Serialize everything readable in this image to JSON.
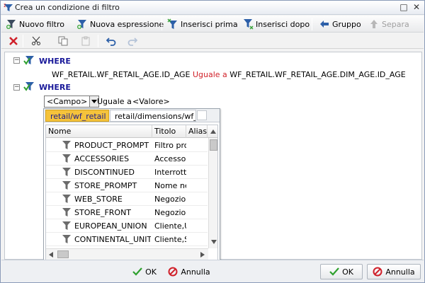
{
  "window": {
    "title": "Crea un condizione di filtro",
    "restore_symbol": "□",
    "close_symbol": "✕"
  },
  "toolbar": {
    "items": [
      {
        "label": "Nuovo filtro",
        "icon": "new-filter-icon"
      },
      {
        "label": "Nuova espressione",
        "icon": "new-expression-icon"
      },
      {
        "label": "Inserisci prima",
        "icon": "insert-before-icon"
      },
      {
        "label": "Inserisci dopo",
        "icon": "insert-after-icon"
      },
      {
        "label": "Gruppo",
        "icon": "group-icon"
      },
      {
        "label": "Separa",
        "icon": "separate-icon",
        "disabled": true
      }
    ]
  },
  "toolbar2": {
    "icons": [
      "delete-icon",
      "cut-icon",
      "copy-icon",
      "paste-icon",
      "undo-icon",
      "redo-icon"
    ]
  },
  "filters": [
    {
      "label": "WHERE",
      "left": "WF_RETAIL.WF_RETAIL_AGE.ID_AGE",
      "operator": "Uguale a",
      "right": "WF_RETAIL.WF_RETAIL_AGE.DIM_AGE.ID_AGE"
    },
    {
      "label": "WHERE",
      "field_placeholder": "<Campo>",
      "operator": "Uguale a",
      "value_placeholder": "<Valore>"
    }
  ],
  "field_picker": {
    "tabs": [
      "retail/wf_retail",
      "retail/dimensions/wf_re"
    ],
    "active_tab": 0,
    "columns": [
      "Nome",
      "Titolo",
      "Alias"
    ],
    "rows": [
      {
        "name": "PRODUCT_PROMPT",
        "title": "Filtro pro"
      },
      {
        "name": "ACCESSORIES",
        "title": "Accessori"
      },
      {
        "name": "DISCONTINUED",
        "title": "Interrotto"
      },
      {
        "name": "STORE_PROMPT",
        "title": "Nome neg"
      },
      {
        "name": "WEB_STORE",
        "title": "Negozio w"
      },
      {
        "name": "STORE_FRONT",
        "title": "Negozio a"
      },
      {
        "name": "EUROPEAN_UNION",
        "title": "Cliente,U"
      },
      {
        "name": "CONTINENTAL_UNITE",
        "title": "Cliente,S"
      }
    ]
  },
  "buttons": {
    "ok": "OK",
    "cancel": "Annulla"
  },
  "colors": {
    "where": "#1a1a9a",
    "operator": "#d1222a",
    "active_tab": "#f5c33b"
  }
}
